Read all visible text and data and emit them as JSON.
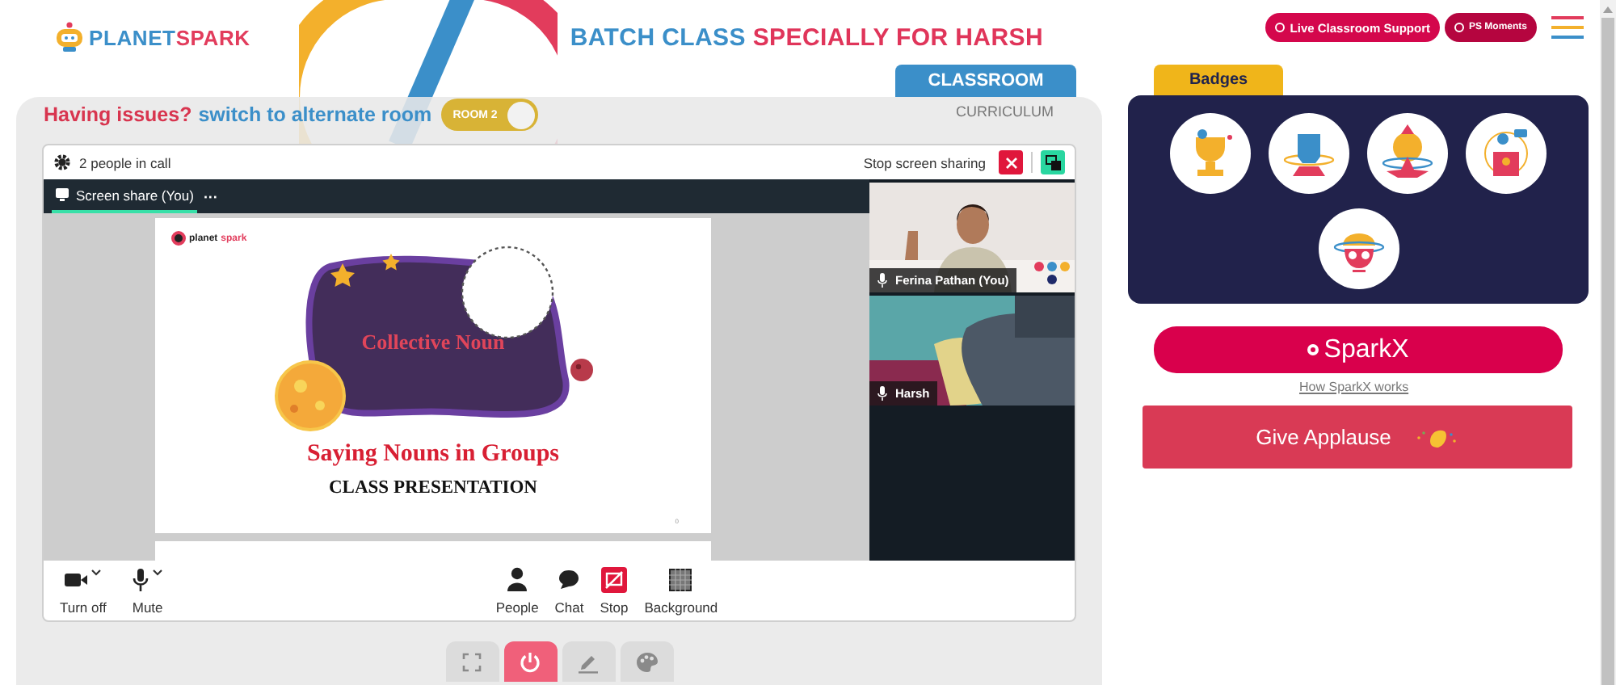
{
  "header": {
    "logo": {
      "part1": "PLANET",
      "part2": "SPARK"
    },
    "title": {
      "part1": "BATCH CLASS",
      "part2": "SPECIALLY FOR HARSH"
    },
    "buttons": [
      {
        "label": "Live Classroom Support",
        "kind": "primary"
      },
      {
        "label": "PS Moments",
        "kind": "secondary"
      }
    ]
  },
  "tabs": [
    {
      "label": "CLASSROOM",
      "selected": true
    },
    {
      "label": "CURRICULUM",
      "selected": false
    }
  ],
  "room_switch": {
    "issue": "Having issues?",
    "link": "switch to alternate room",
    "toggle_label": "ROOM 2",
    "on": true
  },
  "call": {
    "participants": "2 people in call",
    "stop_share": "Stop screen sharing",
    "stage_tab": "Screen share (You)",
    "stage_more": "···",
    "slide": {
      "brand_a": "planet",
      "brand_b": "spark",
      "heading": "Collective Noun",
      "title": "Saying Nouns in Groups",
      "subtitle": "CLASS PRESENTATION",
      "page": "0"
    },
    "tiles": [
      {
        "name": "Ferina Pathan (You)",
        "kind": "teacher"
      },
      {
        "name": "Harsh",
        "kind": "student"
      }
    ],
    "toolbar_left": [
      {
        "label": "Turn off",
        "kind": "camera",
        "menu": true
      },
      {
        "label": "Mute",
        "kind": "mic",
        "menu": true
      }
    ],
    "toolbar_center": [
      {
        "label": "People",
        "kind": "people",
        "active": false
      },
      {
        "label": "Chat",
        "kind": "chat",
        "active": false
      },
      {
        "label": "Stop",
        "kind": "stop-share",
        "active": true
      },
      {
        "label": "Background",
        "kind": "background",
        "active": false
      }
    ]
  },
  "controls": [
    {
      "kind": "fullscreen",
      "active": false
    },
    {
      "kind": "power",
      "active": true
    },
    {
      "kind": "pen",
      "active": false
    },
    {
      "kind": "palette",
      "active": false
    }
  ],
  "badges": {
    "title": "Badges",
    "items": [
      {
        "kind": "trophy"
      },
      {
        "kind": "fist"
      },
      {
        "kind": "wizard"
      },
      {
        "kind": "podium"
      },
      {
        "kind": "brain"
      }
    ]
  },
  "sparkx": {
    "label": "SparkX",
    "link": "How SparkX works"
  },
  "applause": {
    "label": "Give Applause"
  }
}
